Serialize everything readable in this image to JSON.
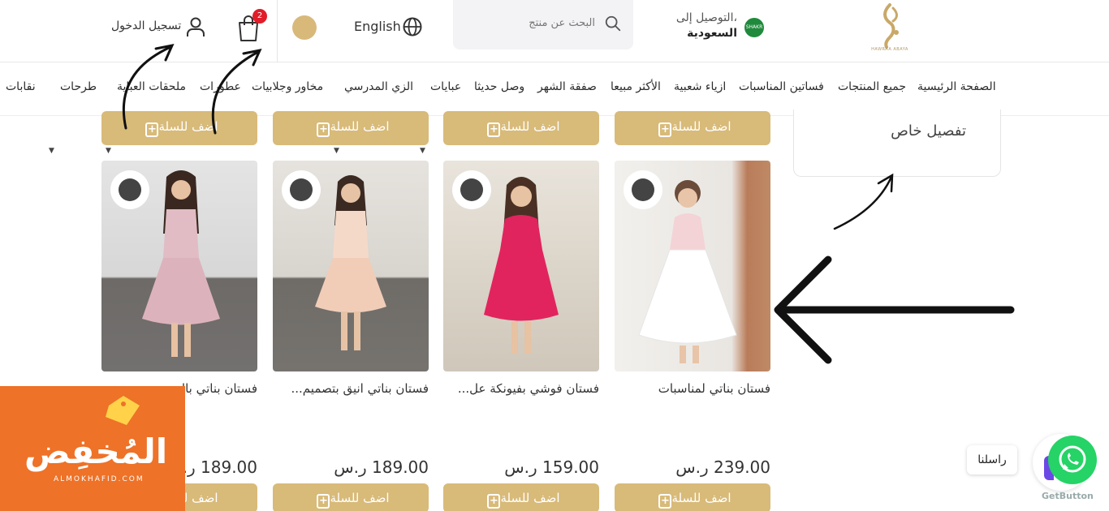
{
  "header": {
    "logo_text": "HAWRAA ABAYA",
    "shipping": {
      "line1": "التوصيل إلى،",
      "line2": "السعودية",
      "flag_text": "SHAKR"
    },
    "search": {
      "placeholder": "البحث عن منتج"
    },
    "language": "English",
    "cart_count": "2",
    "login": "تسجيل الدخول"
  },
  "nav": {
    "items": [
      {
        "label": "الصفحة الرئيسية"
      },
      {
        "label": "جميع المنتجات"
      },
      {
        "label": "فساتين المناسبات"
      },
      {
        "label": "ازياء شعبية"
      },
      {
        "label": "الأكثر مبيعا"
      },
      {
        "label": "صفقة الشهر"
      },
      {
        "label": "وصل حديثا"
      },
      {
        "label": "عبايات"
      },
      {
        "label": "الزي المدرسي"
      },
      {
        "label": "مخاور وجلابيات"
      },
      {
        "label": "عطورات"
      },
      {
        "label": "ملحقات العباية"
      },
      {
        "label": "طرحات"
      },
      {
        "label": "نقابات"
      }
    ]
  },
  "custom_tailoring": "تفصيل خاص",
  "add_to_cart_label": "اضف للسلة",
  "products": [
    {
      "name": "فستان بناتي لمناسبات",
      "price": "239.00 ر.س"
    },
    {
      "name": "فستان فوشي بفيونكة عل...",
      "price": "159.00 ر.س"
    },
    {
      "name": "فستان بناتي انيق بتصميم...",
      "price": "189.00 ر.س"
    },
    {
      "name": "فستان بناتي بالـ...",
      "price": "189.00 ر.س"
    }
  ],
  "promo": {
    "arabic": "المُخفِض",
    "english": "ALMOKHAFID.COM"
  },
  "whatsapp": {
    "label": "راسلنا",
    "brand": "GetButton"
  },
  "colors": {
    "gold": "#d8ba79",
    "promo_orange": "#ee7227",
    "whatsapp_green": "#25d366",
    "badge_red": "#e11d2a"
  }
}
